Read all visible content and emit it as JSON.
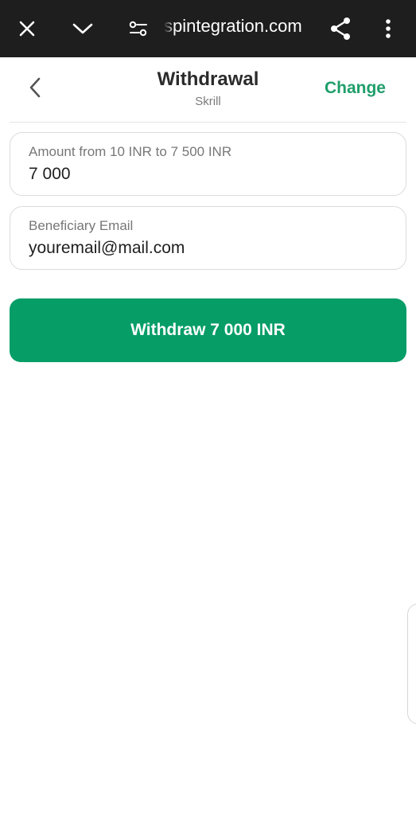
{
  "browser": {
    "url_text": "spintegration.com",
    "icons": {
      "close": "close-icon",
      "tabs": "chevron-down-icon",
      "site_settings": "tune-icon",
      "share": "share-icon",
      "menu": "more-vertical-icon"
    }
  },
  "header": {
    "title": "Withdrawal",
    "subtitle": "Skrill",
    "change_label": "Change",
    "back_icon": "chevron-left-icon"
  },
  "form": {
    "amount": {
      "label": "Amount from 10 INR to 7 500 INR",
      "value": "7 000"
    },
    "email": {
      "label": "Beneficiary Email",
      "value": "youremail@mail.com"
    },
    "submit_label": "Withdraw 7 000 INR"
  },
  "colors": {
    "accent": "#069d67",
    "link": "#1f9e6a",
    "topbar": "#1e1e1e"
  }
}
